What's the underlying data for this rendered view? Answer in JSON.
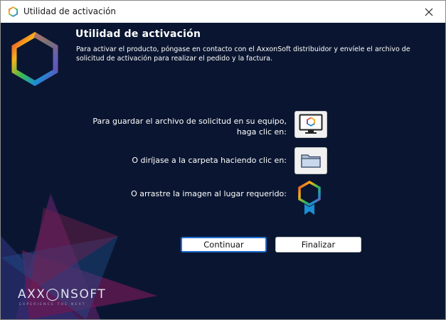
{
  "window": {
    "title": "Utilidad de activación",
    "close_icon": "close-icon"
  },
  "header": {
    "title": "Utilidad de activación",
    "description": "Para activar el producto, póngase en contacto con el AxxonSoft distribuidor y envíele el archivo de solicitud de activación para realizar el pedido y la factura."
  },
  "actions": {
    "save_label_line1": "Para guardar el archivo de solicitud en su equipo,",
    "save_label_line2": "haga clic en:",
    "save_icon": "monitor-icon",
    "folder_label": "O diríjase a la carpeta haciendo clic en:",
    "folder_icon": "folder-icon",
    "drag_label": "O arrastre la imagen al lugar requerido:",
    "drag_icon": "hexagon-badge-icon"
  },
  "buttons": {
    "continue": "Continuar",
    "finish": "Finalizar"
  },
  "brand": {
    "name": "AXX◯NSOFT",
    "tagline": "EXPERIENCE THE NEXT"
  },
  "colors": {
    "background": "#0a1631",
    "accent_border": "#1f6fd1",
    "hex_gradient": [
      "#e8412c",
      "#f7b21b",
      "#3dba4e",
      "#1b8fd6",
      "#7a3fb0",
      "#d62a7e"
    ]
  }
}
